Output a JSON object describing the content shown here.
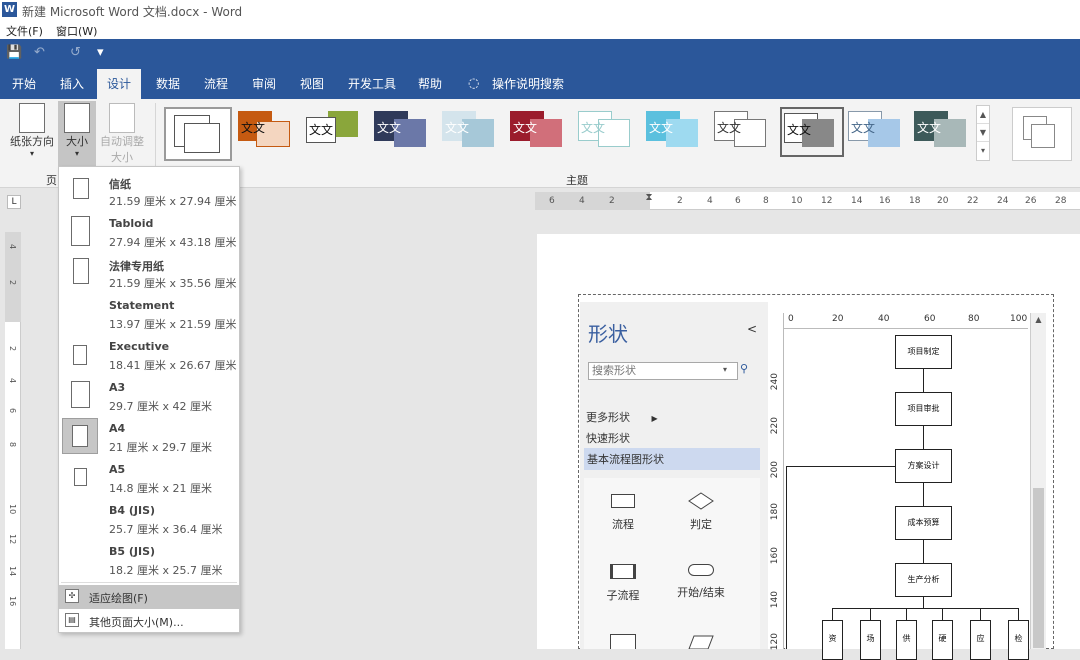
{
  "window": {
    "title": "新建 Microsoft Word 文档.docx - Word",
    "app_icon": "W"
  },
  "menu": {
    "file": "文件(F)",
    "window": "窗口(W)"
  },
  "qat": {
    "save_icon": "💾",
    "undo_icon": "↶",
    "redo_icon": "↺",
    "more_icon": "▾"
  },
  "tabs": [
    "开始",
    "插入",
    "设计",
    "数据",
    "流程",
    "审阅",
    "视图",
    "开发工具",
    "帮助",
    "操作说明搜索"
  ],
  "active_tab": "设计",
  "ribbon": {
    "orientation": "纸张方向",
    "size": "大小",
    "auto_size_line1": "自动调整",
    "auto_size_line2": "大小",
    "group_page": "页",
    "group_theme": "主题",
    "theme_label": "文文"
  },
  "size_menu": {
    "items": [
      {
        "name": "信纸",
        "size": "21.59 厘米 x 27.94 厘米"
      },
      {
        "name": "Tabloid",
        "size": "27.94 厘米 x 43.18 厘米"
      },
      {
        "name": "法律专用纸",
        "size": "21.59 厘米 x 35.56 厘米"
      },
      {
        "name": "Statement",
        "size": "13.97 厘米 x 21.59 厘米"
      },
      {
        "name": "Executive",
        "size": "18.41 厘米 x 26.67 厘米"
      },
      {
        "name": "A3",
        "size": "29.7 厘米 x 42 厘米"
      },
      {
        "name": "A4",
        "size": "21 厘米 x 29.7 厘米"
      },
      {
        "name": "A5",
        "size": "14.8 厘米 x 21 厘米"
      },
      {
        "name": "B4 (JIS)",
        "size": "25.7 厘米 x 36.4 厘米"
      },
      {
        "name": "B5 (JIS)",
        "size": "18.2 厘米 x 25.7 厘米"
      }
    ],
    "selected": "A4",
    "fit": "适应绘图(F)",
    "other": "其他页面大小(M)..."
  },
  "shapes": {
    "title": "形状",
    "search_placeholder": "搜索形状",
    "more": "更多形状",
    "quick": "快速形状",
    "basic": "基本流程图形状",
    "items": [
      "流程",
      "判定",
      "子流程",
      "开始/结束"
    ]
  },
  "visio_ruler_h": [
    "0",
    "20",
    "40",
    "60",
    "80",
    "100"
  ],
  "visio_ruler_v": [
    "240",
    "220",
    "200",
    "180",
    "160",
    "140",
    "120"
  ],
  "flow": [
    "项目制定",
    "项目审批",
    "方案设计",
    "成本预算",
    "生产分析"
  ],
  "flow_sub": [
    "资",
    "场",
    "供",
    "硬",
    "应",
    "检"
  ],
  "top_ruler": [
    "6",
    "4",
    "2",
    "2",
    "4",
    "6",
    "8",
    "10",
    "12",
    "14",
    "16",
    "18",
    "20",
    "22",
    "24",
    "26",
    "28"
  ],
  "left_ruler": [
    "4",
    "2",
    "2",
    "4",
    "6",
    "8",
    "10",
    "12",
    "14",
    "16"
  ]
}
